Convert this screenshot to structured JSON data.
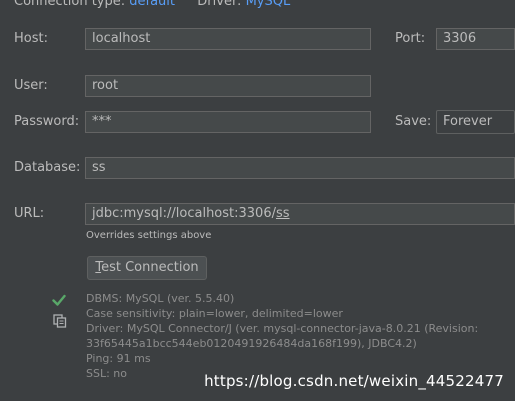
{
  "top": {
    "connection_type_label": "Connection type:",
    "connection_type_value": "default",
    "driver_label": "Driver:",
    "driver_value": "MySQL"
  },
  "host": {
    "label": "Host:",
    "value": "localhost"
  },
  "port": {
    "label": "Port:",
    "value": "3306"
  },
  "user": {
    "label": "User:",
    "value": "root"
  },
  "password": {
    "label": "Password:",
    "value": "***"
  },
  "save": {
    "label": "Save:",
    "value": "Forever"
  },
  "database": {
    "label": "Database:",
    "value": "ss"
  },
  "url": {
    "label": "URL:",
    "value_prefix": "jdbc:mysql://localhost:3306/",
    "value_db": "ss",
    "hint": "Overrides settings above"
  },
  "test_button": {
    "mnemonic": "T",
    "rest": "est Connection"
  },
  "status": {
    "lines": [
      "DBMS: MySQL (ver. 5.5.40)",
      "Case sensitivity: plain=lower, delimited=lower",
      "Driver: MySQL Connector/J (ver. mysql-connector-java-8.0.21 (Revision:",
      "33f65445a1bcc544eb0120491926484da168f199), JDBC4.2)",
      "Ping: 91 ms",
      "SSL: no"
    ]
  },
  "colors": {
    "success": "#59a869",
    "link": "#589df6",
    "background": "#3c3f41"
  },
  "icons": {
    "success": "check-icon",
    "copy": "copy-icon"
  },
  "watermark": "https://blog.csdn.net/weixin_44522477"
}
